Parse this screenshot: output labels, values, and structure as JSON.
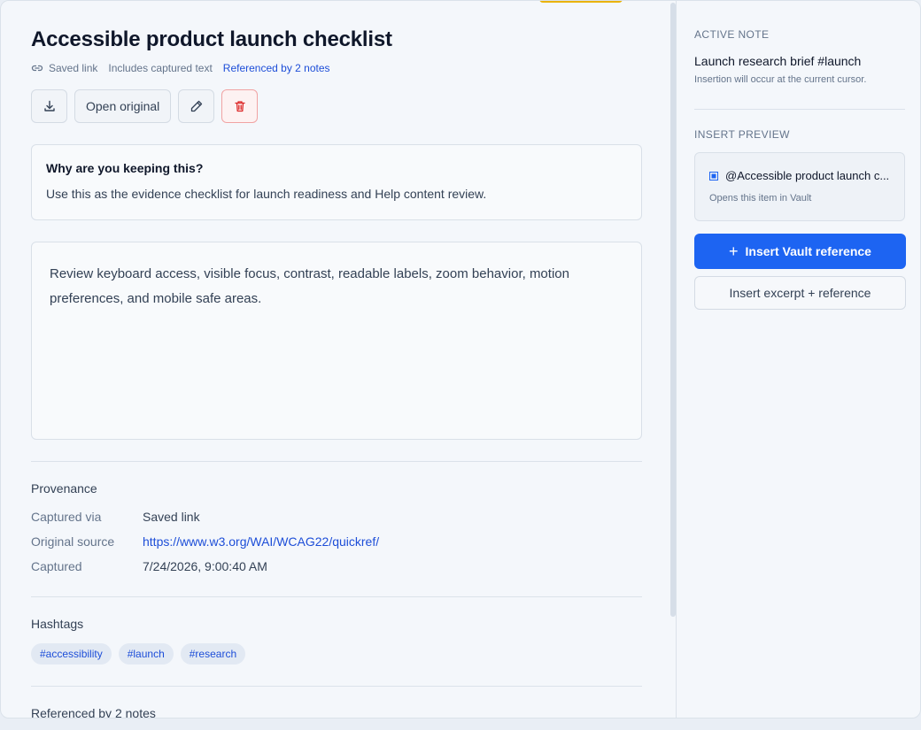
{
  "item": {
    "title": "Accessible product launch checklist",
    "meta": {
      "type_label": "Saved link",
      "text_label": "Includes captured text",
      "references_label": "Referenced by 2 notes"
    },
    "toolbar": {
      "open_original_label": "Open original"
    },
    "reason": {
      "question": "Why are you keeping this?",
      "answer": "Use this as the evidence checklist for launch readiness and Help content review."
    },
    "notes_text": "Review keyboard access, visible focus, contrast, readable labels, zoom behavior, motion preferences, and mobile safe areas.",
    "provenance": {
      "title": "Provenance",
      "rows": [
        {
          "key": "Captured via",
          "value": "Saved link"
        },
        {
          "key": "Original source",
          "value": "https://www.w3.org/WAI/WCAG22/quickref/"
        },
        {
          "key": "Captured",
          "value": "7/24/2026, 9:00:40 AM"
        }
      ]
    },
    "hashtags": {
      "title": "Hashtags",
      "tags": [
        "#accessibility",
        "#launch",
        "#research"
      ]
    },
    "referenced_title": "Referenced by 2 notes"
  },
  "sidebar": {
    "active_note_label": "ACTIVE NOTE",
    "active_note_title": "Launch research brief #launch",
    "active_note_sub": "Insertion will occur at the current cursor.",
    "insert_preview_label": "INSERT PREVIEW",
    "preview_title": "@Accessible product launch c...",
    "preview_sub": "Opens this item in Vault",
    "insert_reference_label": "Insert Vault reference",
    "insert_reference_icon": "+",
    "insert_excerpt_label": "Insert excerpt + reference"
  },
  "colors": {
    "accent": "#1d64f2",
    "link": "#1d4ed8",
    "danger": "#dc2626"
  }
}
